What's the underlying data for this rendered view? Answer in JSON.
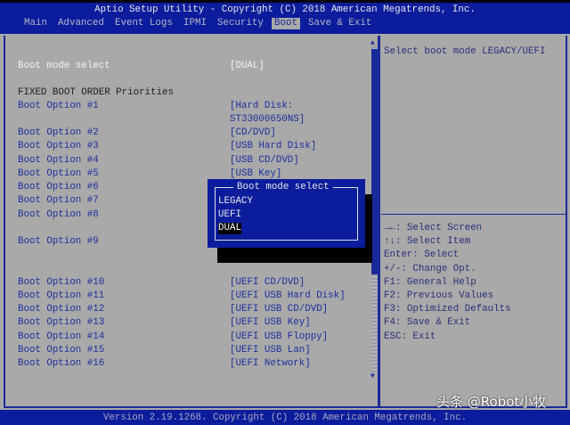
{
  "header": {
    "title": "Aptio Setup Utility - Copyright (C) 2018 American Megatrends, Inc.",
    "tabs": [
      "Main",
      "Advanced",
      "Event Logs",
      "IPMI",
      "Security",
      "Boot",
      "Save & Exit"
    ],
    "active_tab": "Boot"
  },
  "main": {
    "boot_mode": {
      "label": "Boot mode select",
      "value": "[DUAL]"
    },
    "section_heading": "FIXED BOOT ORDER Priorities",
    "options": [
      {
        "label": "Boot Option #1",
        "value": "[Hard Disk:",
        "value2": "ST33000650NS]"
      },
      {
        "label": "Boot Option #2",
        "value": "[CD/DVD]"
      },
      {
        "label": "Boot Option #3",
        "value": "[USB Hard Disk]"
      },
      {
        "label": "Boot Option #4",
        "value": "[USB CD/DVD]"
      },
      {
        "label": "Boot Option #5",
        "value": "[USB Key]"
      },
      {
        "label": "Boot Option #6",
        "value": ""
      },
      {
        "label": "Boot Option #7",
        "value": ""
      },
      {
        "label": "Boot Option #8",
        "value": ""
      },
      {
        "label": "Boot Option #9",
        "value": ""
      },
      {
        "label": "Boot Option #10",
        "value": "[UEFI CD/DVD]"
      },
      {
        "label": "Boot Option #11",
        "value": "[UEFI USB Hard Disk]"
      },
      {
        "label": "Boot Option #12",
        "value": "[UEFI USB CD/DVD]"
      },
      {
        "label": "Boot Option #13",
        "value": "[UEFI USB Key]"
      },
      {
        "label": "Boot Option #14",
        "value": "[UEFI USB Floppy]"
      },
      {
        "label": "Boot Option #15",
        "value": "[UEFI USB Lan]"
      },
      {
        "label": "Boot Option #16",
        "value": "[UEFI Network]"
      }
    ]
  },
  "popup": {
    "title": "Boot mode select",
    "options": [
      "LEGACY",
      "UEFI",
      "DUAL"
    ],
    "selected": "DUAL"
  },
  "help": {
    "description": "Select boot mode LEGACY/UEFI",
    "keys": [
      "→←: Select Screen",
      "↑↓: Select Item",
      "Enter: Select",
      "+/-: Change Opt.",
      "F1: General Help",
      "F2: Previous Values",
      "F3: Optimized Defaults",
      "F4: Save & Exit",
      "ESC: Exit"
    ]
  },
  "footer": {
    "text": "Version 2.19.1268. Copyright (C) 2018 American Megatrends, Inc."
  },
  "watermark": "头条 @Robot小牧",
  "colors": {
    "blue": "#0b1c9c",
    "gray": "#a9a9a9"
  }
}
